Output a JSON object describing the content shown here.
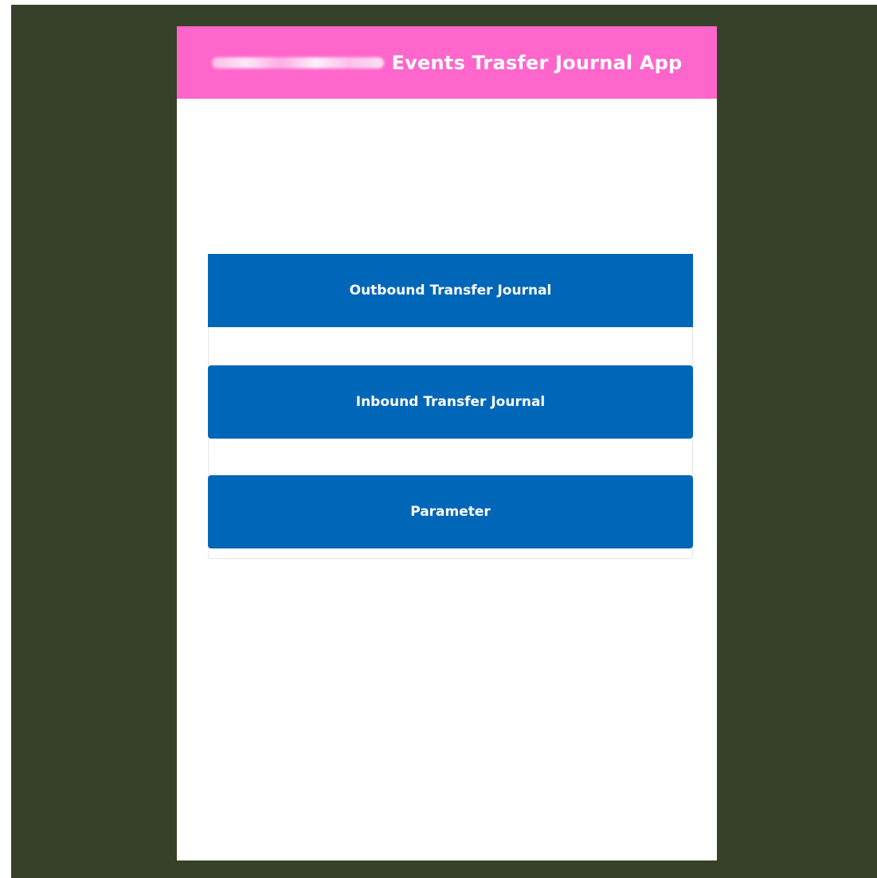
{
  "header": {
    "title": "Events Trasfer Journal App"
  },
  "menu": {
    "items": [
      {
        "label": "Outbound Transfer Journal"
      },
      {
        "label": "Inbound Transfer Journal"
      },
      {
        "label": "Parameter"
      }
    ]
  },
  "colors": {
    "backdrop": "#37412a",
    "header": "#ff66cc",
    "button": "#0066b8",
    "text_on_color": "#ffffff"
  }
}
